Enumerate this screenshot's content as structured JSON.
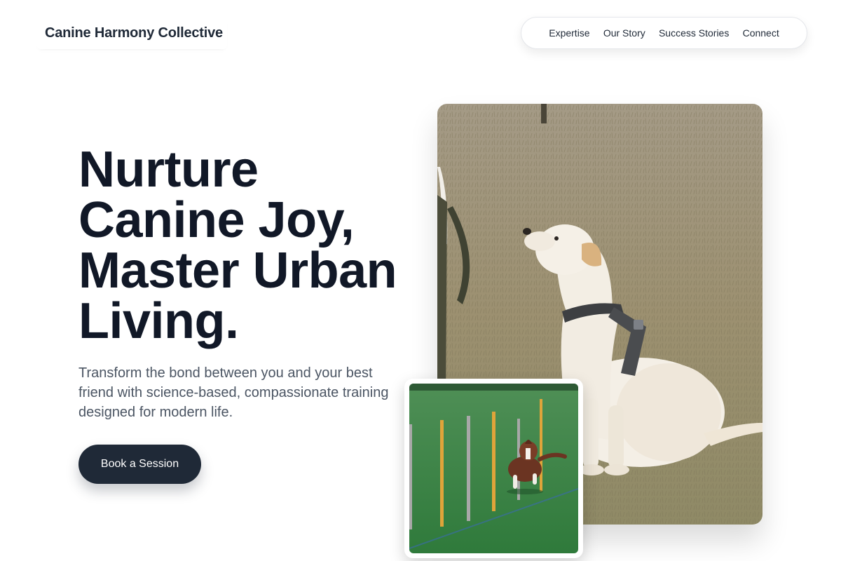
{
  "header": {
    "brand": "Canine Harmony Collective",
    "nav": [
      {
        "label": "Expertise"
      },
      {
        "label": "Our Story"
      },
      {
        "label": "Success Stories"
      },
      {
        "label": "Connect"
      }
    ]
  },
  "hero": {
    "headline_lines": [
      "Nurture",
      "Canine Joy,",
      "Master Urban",
      "Living."
    ],
    "subtext": "Transform the bond between you and your best friend with science-based, compassionate training designed for modern life.",
    "cta_label": "Book a Session"
  },
  "images": {
    "main": {
      "subject": "labrador-sitting-photo"
    },
    "secondary": {
      "subject": "dog-weave-poles-agility-photo"
    }
  },
  "colors": {
    "headline": "#111827",
    "body_text": "#4b5563",
    "cta_background": "#1f2937",
    "cta_text": "#ffffff"
  }
}
